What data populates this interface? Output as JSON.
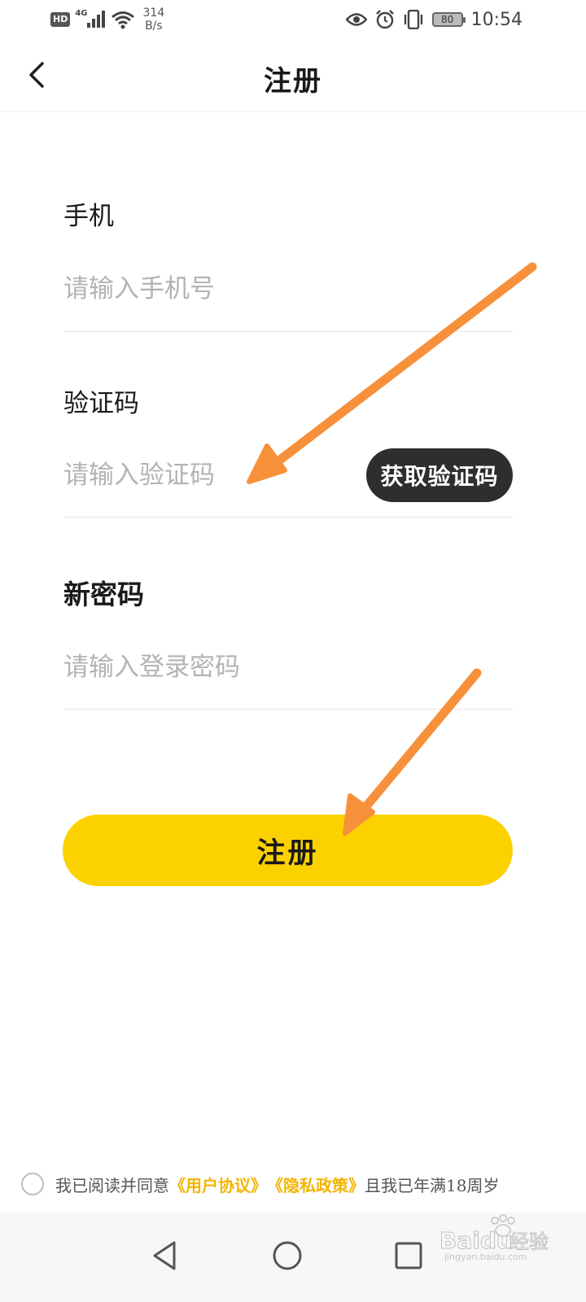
{
  "status_bar": {
    "hd": "HD",
    "network": "4G",
    "speed_value": "314",
    "speed_unit": "B/s",
    "battery": "80",
    "time": "10:54"
  },
  "header": {
    "title": "注册"
  },
  "form": {
    "phone_label": "手机",
    "phone_placeholder": "请输入手机号",
    "code_label": "验证码",
    "code_placeholder": "请输入验证码",
    "get_code_button": "获取验证码",
    "password_label": "新密码",
    "password_placeholder": "请输入登录密码",
    "submit_button": "注册"
  },
  "agreement": {
    "prefix": "我已阅读并同意",
    "user_agreement": "《用户协议》",
    "privacy_policy": "《隐私政策》",
    "suffix": "且我已年满18周岁"
  },
  "watermark": {
    "brand": "Baidu",
    "text": "经验",
    "url": "jingyan.baidu.com"
  },
  "colors": {
    "accent": "#fcd100",
    "link": "#f2b400",
    "dark_button": "#2e2e2e",
    "annotation_arrow": "#f7903a"
  }
}
